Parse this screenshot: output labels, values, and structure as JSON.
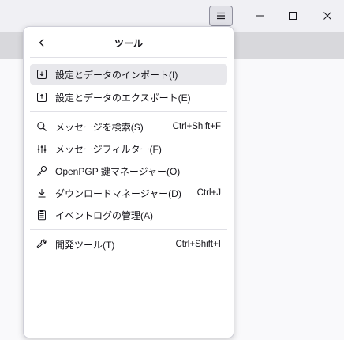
{
  "panel": {
    "title": "ツール",
    "back_icon": "chevron-left-icon"
  },
  "groups": [
    [
      {
        "label": "設定とデータのインポート(I)",
        "shortcut": "",
        "icon": "import-icon",
        "highlighted": true
      },
      {
        "label": "設定とデータのエクスポート(E)",
        "shortcut": "",
        "icon": "export-icon",
        "highlighted": false
      }
    ],
    [
      {
        "label": "メッセージを検索(S)",
        "shortcut": "Ctrl+Shift+F",
        "icon": "search-icon",
        "highlighted": false
      },
      {
        "label": "メッセージフィルター(F)",
        "shortcut": "",
        "icon": "filter-icon",
        "highlighted": false
      },
      {
        "label": "OpenPGP 鍵マネージャー(O)",
        "shortcut": "",
        "icon": "key-icon",
        "highlighted": false
      },
      {
        "label": "ダウンロードマネージャー(D)",
        "shortcut": "Ctrl+J",
        "icon": "download-icon",
        "highlighted": false
      },
      {
        "label": "イベントログの管理(A)",
        "shortcut": "",
        "icon": "clipboard-icon",
        "highlighted": false
      }
    ],
    [
      {
        "label": "開発ツール(T)",
        "shortcut": "Ctrl+Shift+I",
        "icon": "wrench-icon",
        "highlighted": false
      }
    ]
  ],
  "window_controls": {
    "menu_icon": "hamburger-menu-icon",
    "minimize_icon": "minimize-icon",
    "maximize_icon": "maximize-icon",
    "close_icon": "close-icon"
  }
}
